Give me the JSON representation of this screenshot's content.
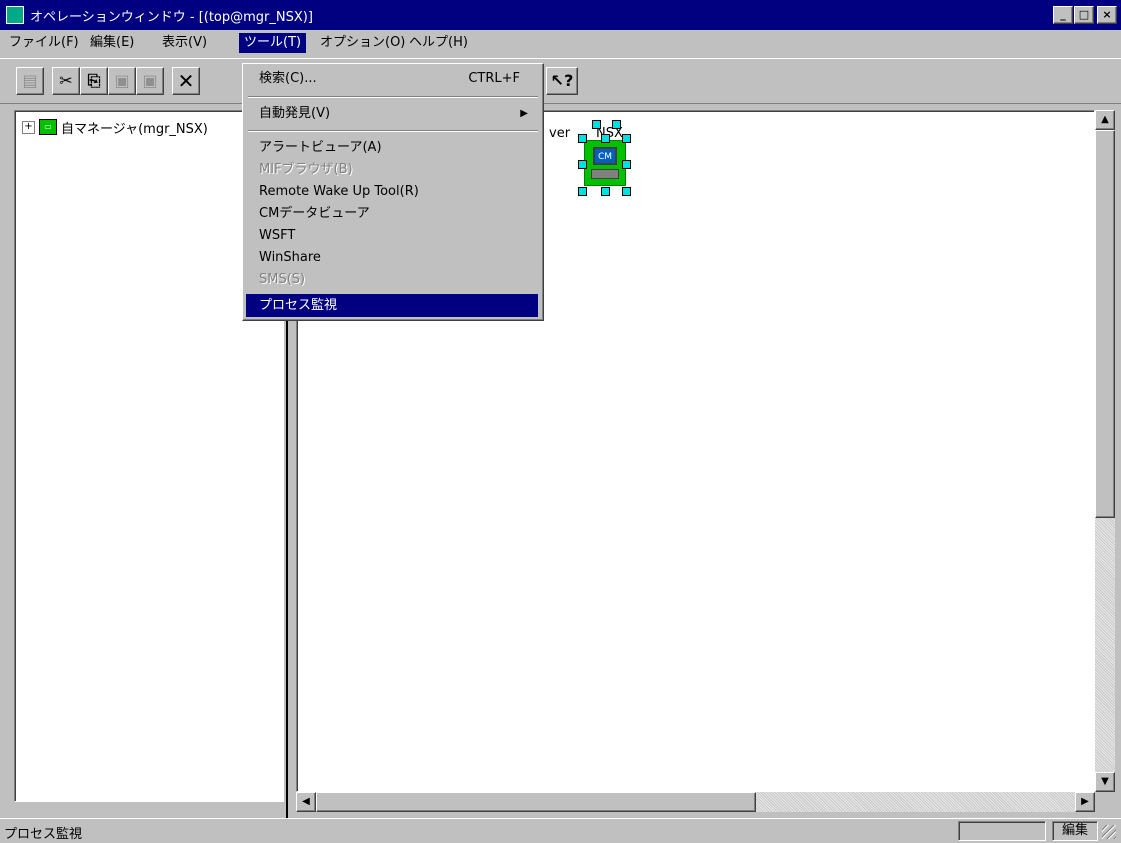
{
  "window": {
    "title": "オペレーションウィンドウ - [(top@mgr_NSX)]"
  },
  "menubar": {
    "items": [
      "ファイル(F)",
      "編集(E)",
      "表示(V)",
      "ツール(T)",
      "オプション(O)",
      "ヘルプ(H)"
    ]
  },
  "toolbar": {
    "help_button": "?"
  },
  "tree": {
    "root_label": "自マネージャ(mgr_NSX)"
  },
  "map": {
    "partial_label_left": "ver",
    "node_label": "NSX",
    "node_icon_text": "CM"
  },
  "tools_menu": {
    "search": {
      "label": "検索(C)...",
      "shortcut": "CTRL+F"
    },
    "auto_discovery": {
      "label": "自動発見(V)"
    },
    "alert_viewer": {
      "label": "アラートビューア(A)"
    },
    "mif_browser": {
      "label": "MIFブラウザ(B)"
    },
    "remote_wake_up": {
      "label": "Remote Wake Up Tool(R)"
    },
    "cm_data_viewer": {
      "label": "CMデータビューア"
    },
    "wsft": {
      "label": "WSFT"
    },
    "winshare": {
      "label": "WinShare"
    },
    "sms": {
      "label": "SMS(S)"
    },
    "process_monitor": {
      "label": "プロセス監視"
    }
  },
  "statusbar": {
    "message": "プロセス監視",
    "mode": "編集"
  },
  "colors": {
    "titlebar": "#000080",
    "highlight": "#000080",
    "face": "#c0c0c0",
    "node": "#00c000",
    "handle": "#00e0e0"
  }
}
